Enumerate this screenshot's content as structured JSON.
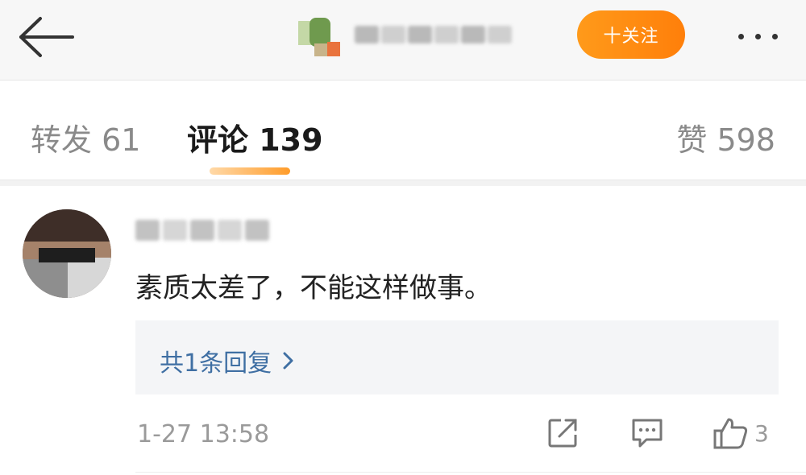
{
  "header": {
    "back_icon": "arrow-left-icon",
    "follow_label": "十关注",
    "more_icon": "more-horizontal-icon",
    "accent": "#ff8a14"
  },
  "tabs": {
    "repost": "转发 61",
    "comment": "评论 139",
    "like": "赞 598"
  },
  "comment": {
    "text": "素质太差了，不能这样做事。",
    "reply_link": "共1条回复",
    "time": "1-27 13:58",
    "like_count": "3",
    "icons": [
      "forward-icon",
      "comment-icon",
      "like-icon"
    ]
  }
}
